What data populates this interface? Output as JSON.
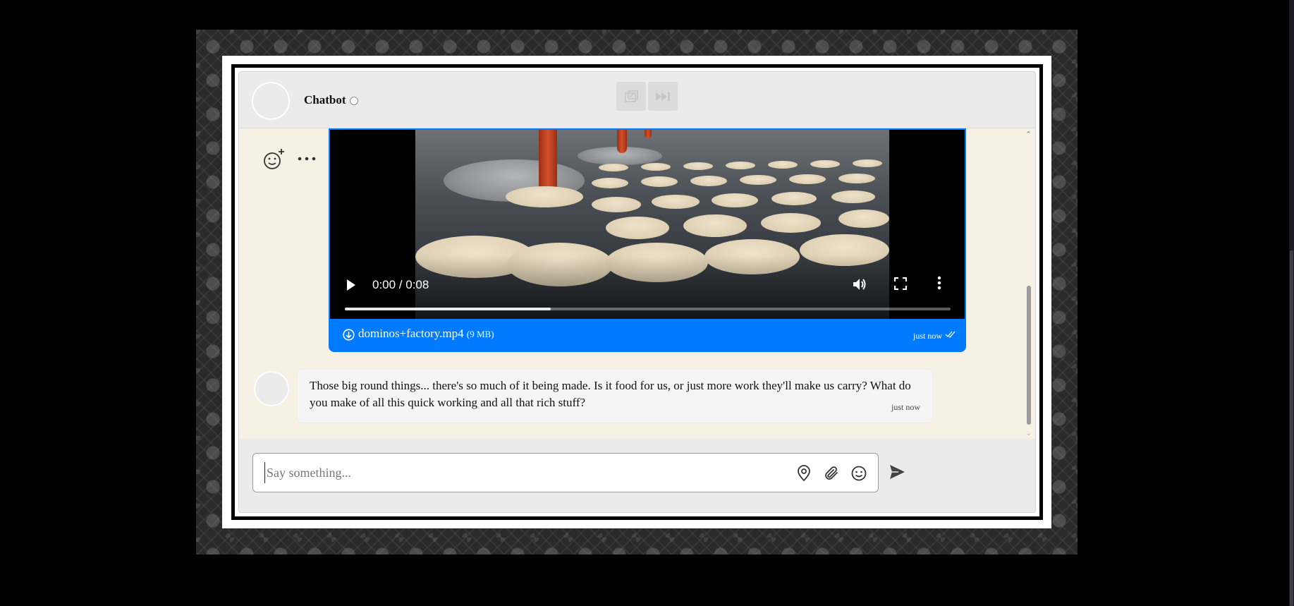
{
  "header": {
    "title": "Chatbot"
  },
  "video_message": {
    "time_display": "0:00 / 0:08",
    "progress_buffered_fraction": 0.34,
    "file_name": "dominos+factory.mp4",
    "file_size": "(9 MB)",
    "timestamp": "just now"
  },
  "bot_message": {
    "text": "Those big round things... there's so much of it being made. Is it food for us, or just more work they'll make us carry? What do you make of all this quick working and all that rich stuff?",
    "timestamp": "just now"
  },
  "composer": {
    "placeholder": "Say something..."
  },
  "icons": {
    "reaction": "add-reaction-icon",
    "more": "more-options-icon",
    "play": "play-icon",
    "volume": "volume-icon",
    "fullscreen": "fullscreen-icon",
    "video_menu": "kebab-menu-icon",
    "download": "download-icon",
    "read_receipt": "double-check-icon",
    "location": "location-pin-icon",
    "attach": "paperclip-icon",
    "emoji": "emoji-icon",
    "send": "send-icon",
    "popout": "popout-icon",
    "skip": "skip-icon"
  },
  "colors": {
    "accent": "#007bff",
    "chat_background": "#f7f0e4",
    "header_background": "#ebebeb"
  }
}
